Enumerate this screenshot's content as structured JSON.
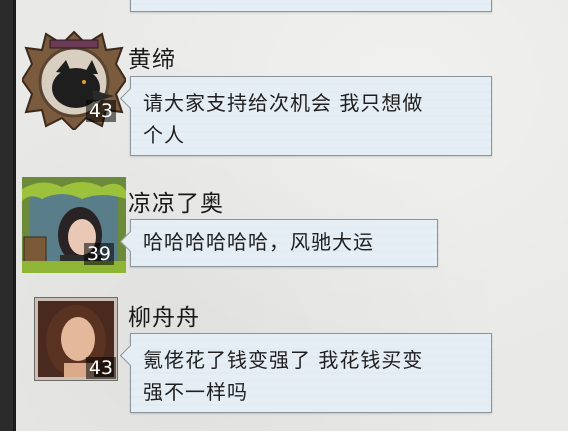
{
  "messages": [
    {
      "name": "黄缔",
      "level": "43",
      "text_line1": "请大家支持给次机会 我只想做",
      "text_line2": "个人",
      "avatar_icon": "wolf-frame-avatar"
    },
    {
      "name": "凉凉了奥",
      "level": "39",
      "text_line1": "哈哈哈哈哈哈，风驰大运",
      "avatar_icon": "green-frame-portrait-avatar"
    },
    {
      "name": "柳舟舟",
      "level": "43",
      "text_line1": "氪佬花了钱变强了 我花钱买变",
      "text_line2": "强不一样吗",
      "avatar_icon": "portrait-avatar"
    }
  ]
}
